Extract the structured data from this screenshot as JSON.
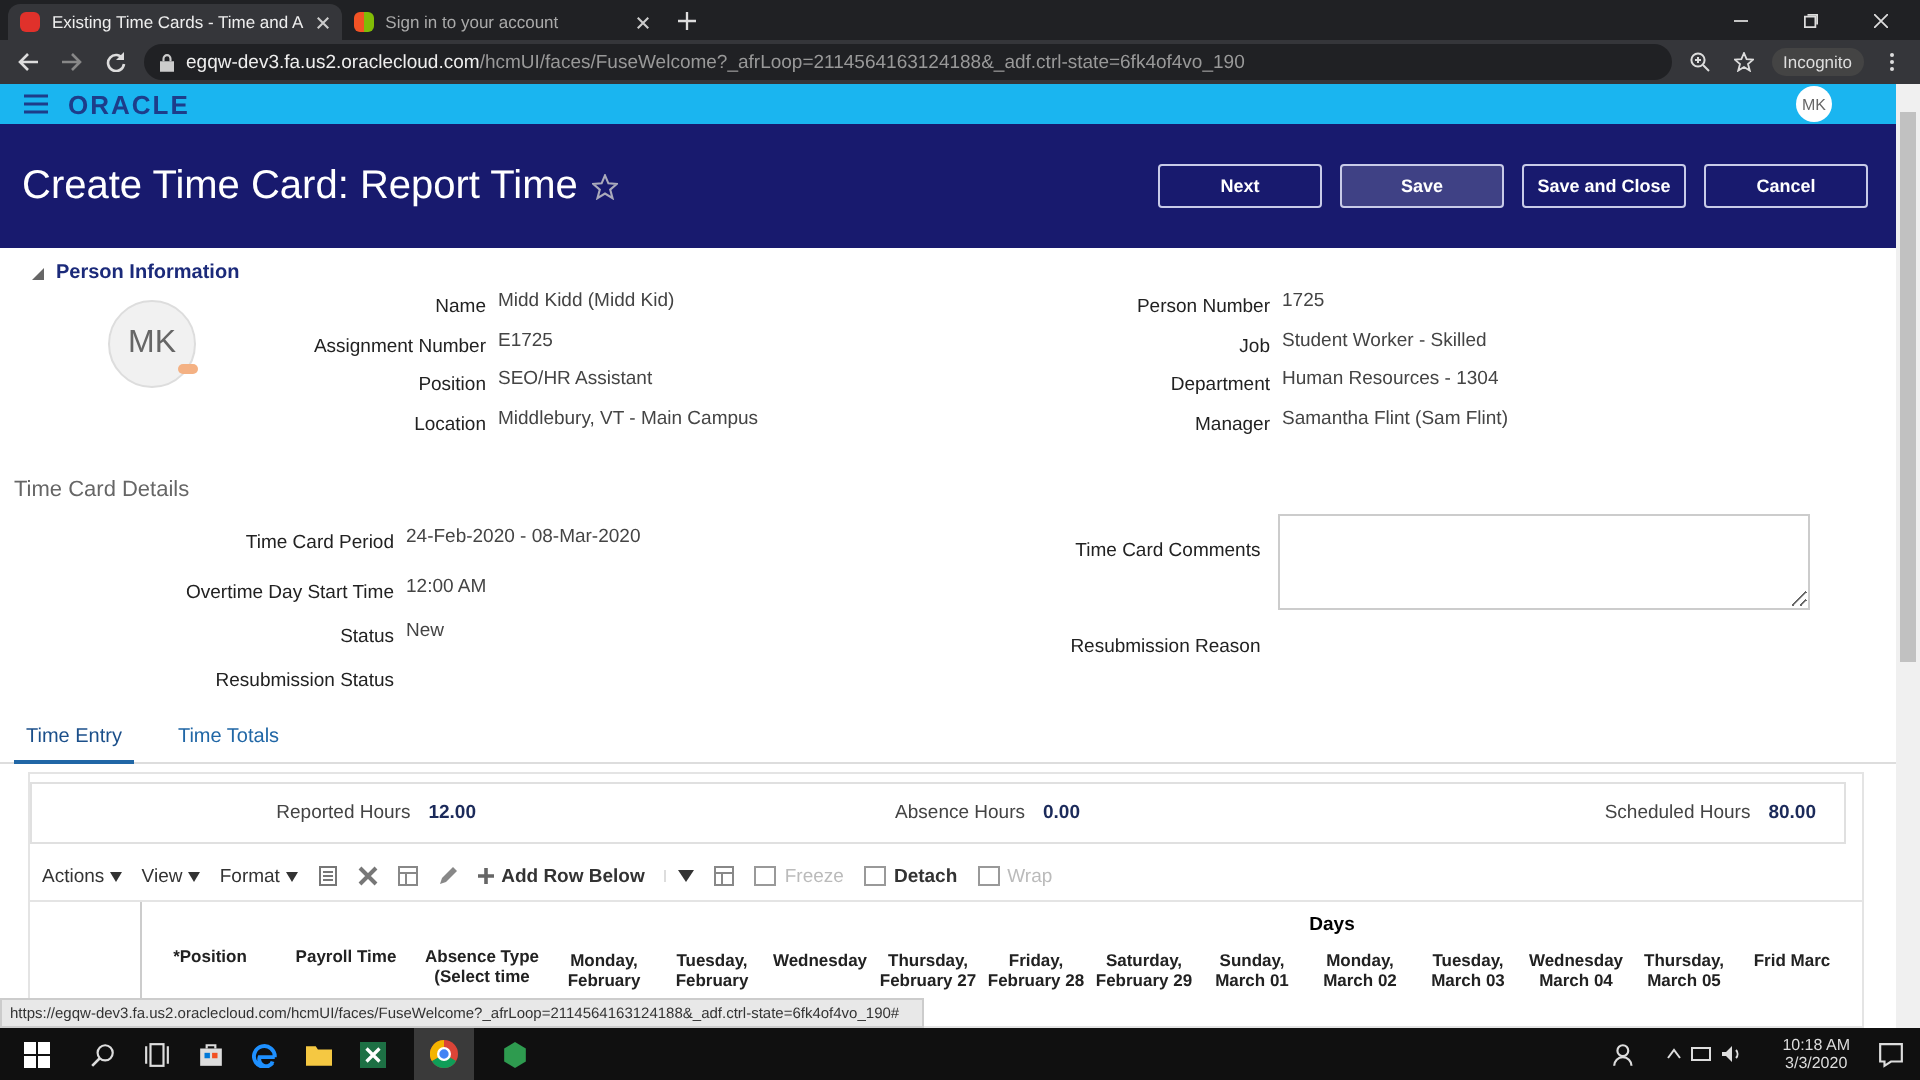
{
  "browser": {
    "tabs": [
      {
        "title": "Existing Time Cards - Time and A",
        "selected": true
      },
      {
        "title": "Sign in to your account",
        "selected": false
      }
    ],
    "url_host": "egqw-dev3.fa.us2.oraclecloud.com",
    "url_path": "/hcmUI/faces/FuseWelcome?_afrLoop=2114564163124188&_adf.ctrl-state=6fk4of4vo_190",
    "profile": "Incognito"
  },
  "app_bar": {
    "logo": "ORACLE",
    "avatar": "MK"
  },
  "header": {
    "title": "Create Time Card: Report Time",
    "buttons": [
      {
        "label": "Next",
        "hover": false
      },
      {
        "label": "Save",
        "hover": true
      },
      {
        "label": "Save and Close",
        "hover": false
      },
      {
        "label": "Cancel",
        "hover": false
      }
    ]
  },
  "person": {
    "section": "Person Information",
    "expanded": true,
    "initials": "MK",
    "left": [
      {
        "label": "Name",
        "value": "Midd Kidd (Midd Kid)"
      },
      {
        "label": "Assignment Number",
        "value": "E1725"
      },
      {
        "label": "Position",
        "value": "SEO/HR Assistant"
      },
      {
        "label": "Location",
        "value": "Middlebury, VT - Main Campus"
      }
    ],
    "right": [
      {
        "label": "Person Number",
        "value": "1725"
      },
      {
        "label": "Job",
        "value": "Student Worker - Skilled"
      },
      {
        "label": "Department",
        "value": "Human Resources - 1304"
      },
      {
        "label": "Manager",
        "value": "Samantha Flint (Sam Flint)"
      }
    ]
  },
  "details": {
    "title": "Time Card Details",
    "left": [
      {
        "label": "Time Card Period",
        "value": "24-Feb-2020 - 08-Mar-2020"
      },
      {
        "label": "Overtime Day Start Time",
        "value": "12:00 AM"
      },
      {
        "label": "Status",
        "value": "New"
      },
      {
        "label": "Resubmission Status"
      }
    ],
    "right": [
      {
        "label": "Time Card Comments",
        "kind": "textarea"
      },
      {
        "label": "Resubmission Reason",
        "kind": "text"
      }
    ]
  },
  "tabs": [
    {
      "label": "Time Entry",
      "selected": true
    },
    {
      "label": "Time Totals",
      "selected": false
    }
  ],
  "summary": [
    {
      "label": "Reported Hours",
      "value": "12.00"
    },
    {
      "label": "Absence Hours",
      "value": "0.00"
    },
    {
      "label": "Scheduled Hours",
      "value": "80.00"
    }
  ],
  "toolbar": [
    {
      "kind": "menu",
      "label": "Actions"
    },
    {
      "kind": "menu",
      "label": "View"
    },
    {
      "kind": "menu",
      "label": "Format"
    },
    {
      "kind": "icon"
    },
    {
      "kind": "icon"
    },
    {
      "kind": "icon"
    },
    {
      "kind": "icon"
    },
    {
      "kind": "add",
      "label": "Add Row Below"
    },
    {
      "kind": "split"
    },
    {
      "kind": "icon"
    },
    {
      "kind": "toggle",
      "label": "Freeze",
      "disabled": true
    },
    {
      "kind": "toggle",
      "label": "Detach",
      "disabled": false
    },
    {
      "kind": "toggle",
      "label": "Wrap",
      "disabled": true
    }
  ],
  "table": {
    "group": "Days",
    "columns": [
      "*Position",
      "Payroll Time",
      "Absence Type (Select time",
      "Monday, February",
      "Tuesday, February",
      "Wednesday",
      "Thursday, February 27",
      "Friday, February 28",
      "Saturday, February 29",
      "Sunday, March 01",
      "Monday, March 02",
      "Tuesday, March 03",
      "Wednesday March 04",
      "Thursday, March 05",
      "Frid Marc"
    ]
  },
  "status_url": "https://egqw-dev3.fa.us2.oraclecloud.com/hcmUI/faces/FuseWelcome?_afrLoop=2114564163124188&_adf.ctrl-state=6fk4of4vo_190#",
  "taskbar": {
    "time": "10:18 AM",
    "date": "3/3/2020"
  }
}
